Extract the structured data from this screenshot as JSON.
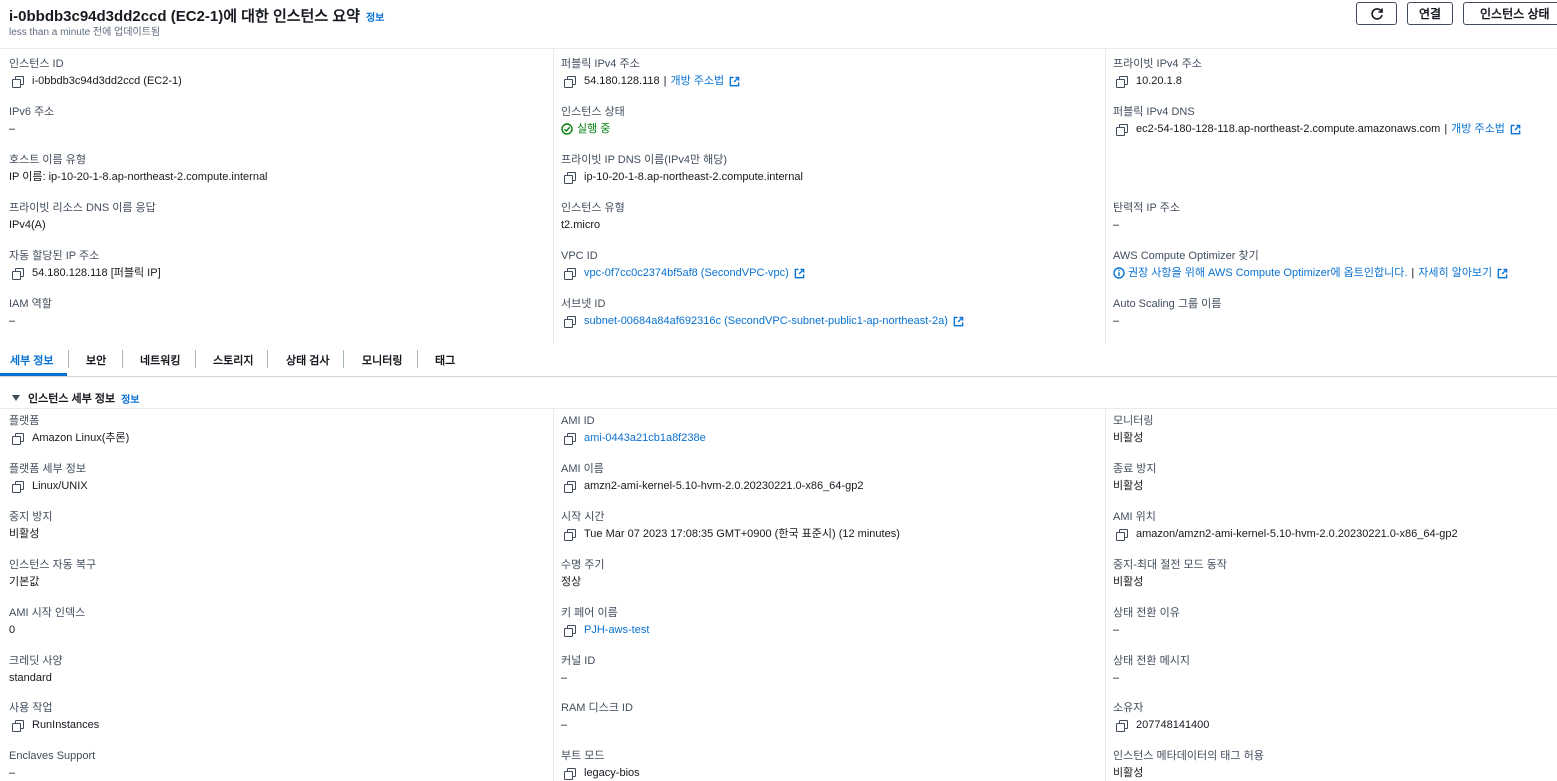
{
  "header": {
    "title": "i-0bbdb3c94d3dd2ccd (EC2-1)에 대한 인스턴스 요약",
    "info_link": "정보",
    "subtitle": "less than a minute 전에 업데이트됨",
    "connect_label": "연결",
    "state_label": "인스턴스 상태"
  },
  "summary": {
    "instance_id": {
      "label": "인스턴스 ID",
      "value": "i-0bbdb3c94d3dd2ccd (EC2-1)"
    },
    "public_ipv4": {
      "label": "퍼블릭 IPv4 주소",
      "value": "54.180.128.118",
      "link": "개방 주소법"
    },
    "private_ipv4": {
      "label": "프라이빗 IPv4 주소",
      "value": "10.20.1.8"
    },
    "ipv6": {
      "label": "IPv6 주소",
      "value": "–"
    },
    "instance_state": {
      "label": "인스턴스 상태",
      "value": "실행 중"
    },
    "public_dns": {
      "label": "퍼블릭 IPv4 DNS",
      "value": "ec2-54-180-128-118.ap-northeast-2.compute.amazonaws.com",
      "link": "개방 주소법"
    },
    "hostname_type": {
      "label": "호스트 이름 유형",
      "value": "IP 이름: ip-10-20-1-8.ap-northeast-2.compute.internal"
    },
    "private_dns": {
      "label": "프라이빗 IP DNS 이름(IPv4만 해당)",
      "value": "ip-10-20-1-8.ap-northeast-2.compute.internal"
    },
    "resource_dns": {
      "label": "프라이빗 리소스 DNS 이름 응답",
      "value": "IPv4(A)"
    },
    "instance_type": {
      "label": "인스턴스 유형",
      "value": "t2.micro"
    },
    "elastic_ip": {
      "label": "탄력적 IP 주소",
      "value": "–"
    },
    "auto_ip": {
      "label": "자동 할당된 IP 주소",
      "value": "54.180.128.118 [퍼블릭 IP]"
    },
    "vpc_id": {
      "label": "VPC ID",
      "value": "vpc-0f7cc0c2374bf5af8 (SecondVPC-vpc)"
    },
    "optimizer": {
      "label": "AWS Compute Optimizer 찾기",
      "value": "권장 사항을 위해 AWS Compute Optimizer에 옵트인합니다.",
      "link": "자세히 알아보기"
    },
    "iam_role": {
      "label": "IAM 역할",
      "value": "–"
    },
    "subnet_id": {
      "label": "서브넷 ID",
      "value": "subnet-00684a84af692316c (SecondVPC-subnet-public1-ap-northeast-2a)"
    },
    "asg": {
      "label": "Auto Scaling 그룹 이름",
      "value": "–"
    }
  },
  "tabs": [
    "세부 정보",
    "보안",
    "네트워킹",
    "스토리지",
    "상태 검사",
    "모니터링",
    "태그"
  ],
  "details": {
    "section_title": "인스턴스 세부 정보",
    "info_link": "정보",
    "platform": {
      "label": "플랫폼",
      "value": "Amazon Linux(추론)"
    },
    "ami_id": {
      "label": "AMI ID",
      "value": "ami-0443a21cb1a8f238e"
    },
    "monitoring": {
      "label": "모니터링",
      "value": "비활성"
    },
    "platform_detail": {
      "label": "플랫폼 세부 정보",
      "value": "Linux/UNIX"
    },
    "ami_name": {
      "label": "AMI 이름",
      "value": "amzn2-ami-kernel-5.10-hvm-2.0.20230221.0-x86_64-gp2"
    },
    "termination": {
      "label": "종료 방지",
      "value": "비활성"
    },
    "stop_protection": {
      "label": "중지 방지",
      "value": "비활성"
    },
    "launch_time": {
      "label": "시작 시간",
      "value": "Tue Mar 07 2023 17:08:35 GMT+0900 (한국 표준시) (12 minutes)"
    },
    "ami_location": {
      "label": "AMI 위치",
      "value": "amazon/amzn2-ami-kernel-5.10-hvm-2.0.20230221.0-x86_64-gp2"
    },
    "auto_recovery": {
      "label": "인스턴스 자동 복구",
      "value": "기본값"
    },
    "lifecycle": {
      "label": "수명 주기",
      "value": "정상"
    },
    "stop_hibernate": {
      "label": "중지-최대 절전 모드 동작",
      "value": "비활성"
    },
    "ami_launch_index": {
      "label": "AMI 시작 인덱스",
      "value": "0"
    },
    "key_pair": {
      "label": "키 페어 이름",
      "value": "PJH-aws-test"
    },
    "transition_reason": {
      "label": "상태 전환 이유",
      "value": "–"
    },
    "credit": {
      "label": "크레딧 사양",
      "value": "standard"
    },
    "kernel_id": {
      "label": "커널 ID",
      "value": "–"
    },
    "transition_msg": {
      "label": "상태 전환 메시지",
      "value": "–"
    },
    "usage": {
      "label": "사용 작업",
      "value": "RunInstances"
    },
    "ramdisk": {
      "label": "RAM 디스크 ID",
      "value": "–"
    },
    "owner": {
      "label": "소유자",
      "value": "207748141400"
    },
    "enclaves": {
      "label": "Enclaves Support",
      "value": "–"
    },
    "boot_mode": {
      "label": "부트 모드",
      "value": "legacy-bios"
    },
    "metadata_tags": {
      "label": "인스턴스 메타데이터의 태그 허용",
      "value": "비활성"
    }
  }
}
